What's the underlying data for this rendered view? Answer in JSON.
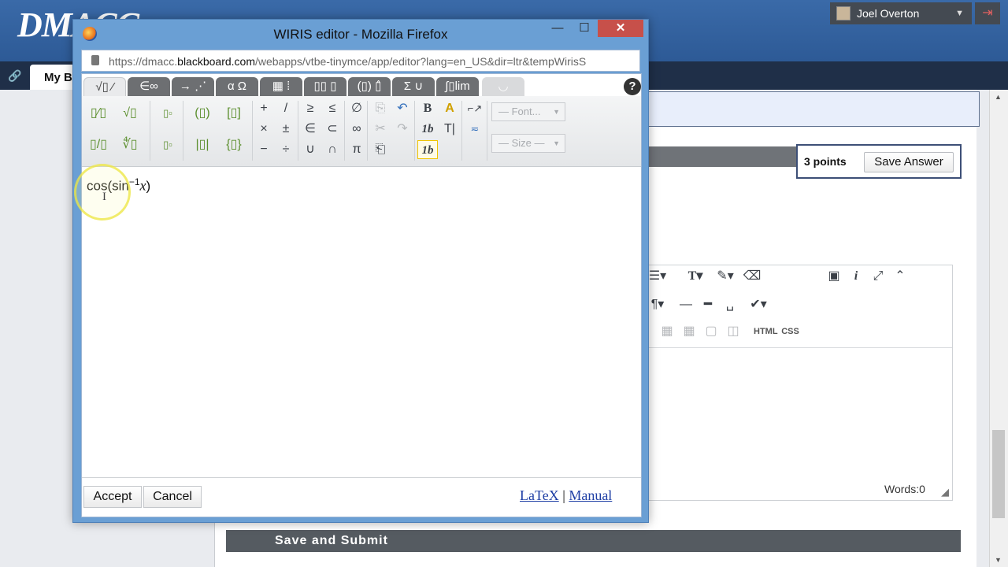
{
  "background": {
    "logo_text": "DMACC",
    "user_name": "Joel Overton",
    "tab_label": "My B",
    "points_label": "3 points",
    "save_answer_label": "Save Answer",
    "save_submit_label": "Save and Submit",
    "editor_words": "Words:0",
    "editor_html_label": "HTML",
    "editor_css_label": "CSS"
  },
  "window": {
    "title": "WIRIS editor - Mozilla Firefox",
    "minimize": "—",
    "maximize": "☐",
    "close": "✕",
    "url_prefix": "https://dmacc.",
    "url_domain": "blackboard.com",
    "url_rest": "/webapps/vtbe-tinymce/app/editor?lang=en_US&dir=ltr&tempWirisS"
  },
  "wiris": {
    "tabs": [
      "√▯ ⁄",
      "∈∞",
      "→ ⋰",
      "α Ω",
      "▦ ⁞",
      "▯▯ ▯",
      "(▯) ▯̂",
      "Σ ∪",
      "∫▯lim",
      "◡"
    ],
    "help": "?",
    "toolbar": {
      "frac": "▯⁄▯",
      "sqrt": "√▯",
      "sup": "▯▫",
      "paren": "(▯)",
      "bracket": "[▯]",
      "plus": "+",
      "slash": "/",
      "geq": "≥",
      "leq": "≤",
      "emptyset": "∅",
      "bfrac": "▯/▯",
      "nroot": "∜▯",
      "sub": "▯▫",
      "abs": "|▯|",
      "brace": "{▯}",
      "times": "×",
      "pm": "±",
      "in": "∈",
      "subset": "⊂",
      "infty": "∞",
      "minus": "−",
      "div": "÷",
      "cup": "∪",
      "cap": "∩",
      "pi": "π",
      "copy": "⎘",
      "cut": "✂",
      "paste": "⎗",
      "undo": "↶",
      "redo": "↷",
      "bold": "B",
      "italic_1b": "1b",
      "text_mode": "T|",
      "italic_sel": "1b",
      "font_placeholder": "— Font...",
      "size_placeholder": "— Size —"
    },
    "formula": {
      "func1": "cos(",
      "func2": "sin",
      "exponent": "−1",
      "var": "x",
      "close": ")"
    },
    "accept_label": "Accept",
    "cancel_label": "Cancel",
    "latex_label": "LaTeX",
    "separator": "|",
    "manual_label": "Manual"
  }
}
